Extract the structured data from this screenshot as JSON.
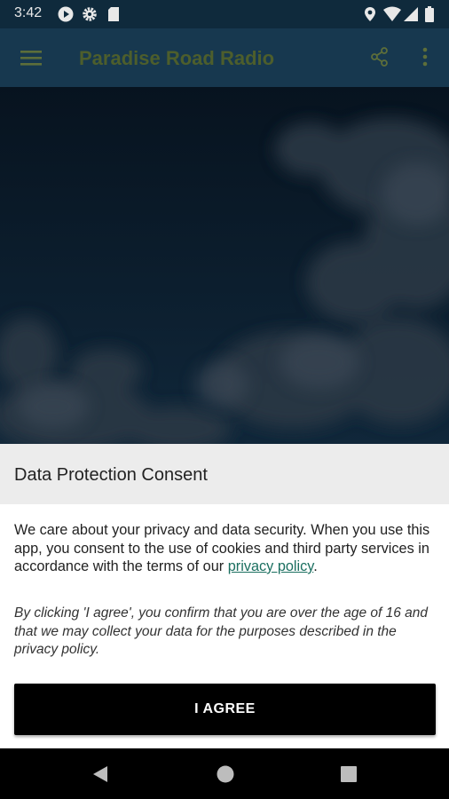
{
  "status_bar": {
    "time": "3:42",
    "left_icons": [
      "play-circle-icon",
      "gear-icon",
      "sd-card-icon"
    ],
    "right_icons": [
      "location-icon",
      "wifi-icon",
      "signal-icon",
      "battery-icon"
    ]
  },
  "app_bar": {
    "title": "Paradise Road Radio",
    "title_color": "#4d5e2c",
    "background": "#17384f",
    "icons": [
      "menu-icon",
      "share-icon",
      "more-vert-icon"
    ]
  },
  "consent": {
    "title": "Data Protection Consent",
    "body_text": "We care about your privacy and data security. When you use this app, you consent to the use of cookies and third party services in accordance with the terms of our ",
    "link_text": "privacy policy",
    "body_end": ".",
    "link_color": "#1b6f60",
    "note": "By clicking 'I agree', you confirm that you are over the age of 16 and that we may collect your data for the purposes described in the privacy policy.",
    "agree_label": "I AGREE"
  },
  "nav_bar": {
    "icons": [
      "back-icon",
      "home-icon",
      "recents-icon"
    ]
  }
}
